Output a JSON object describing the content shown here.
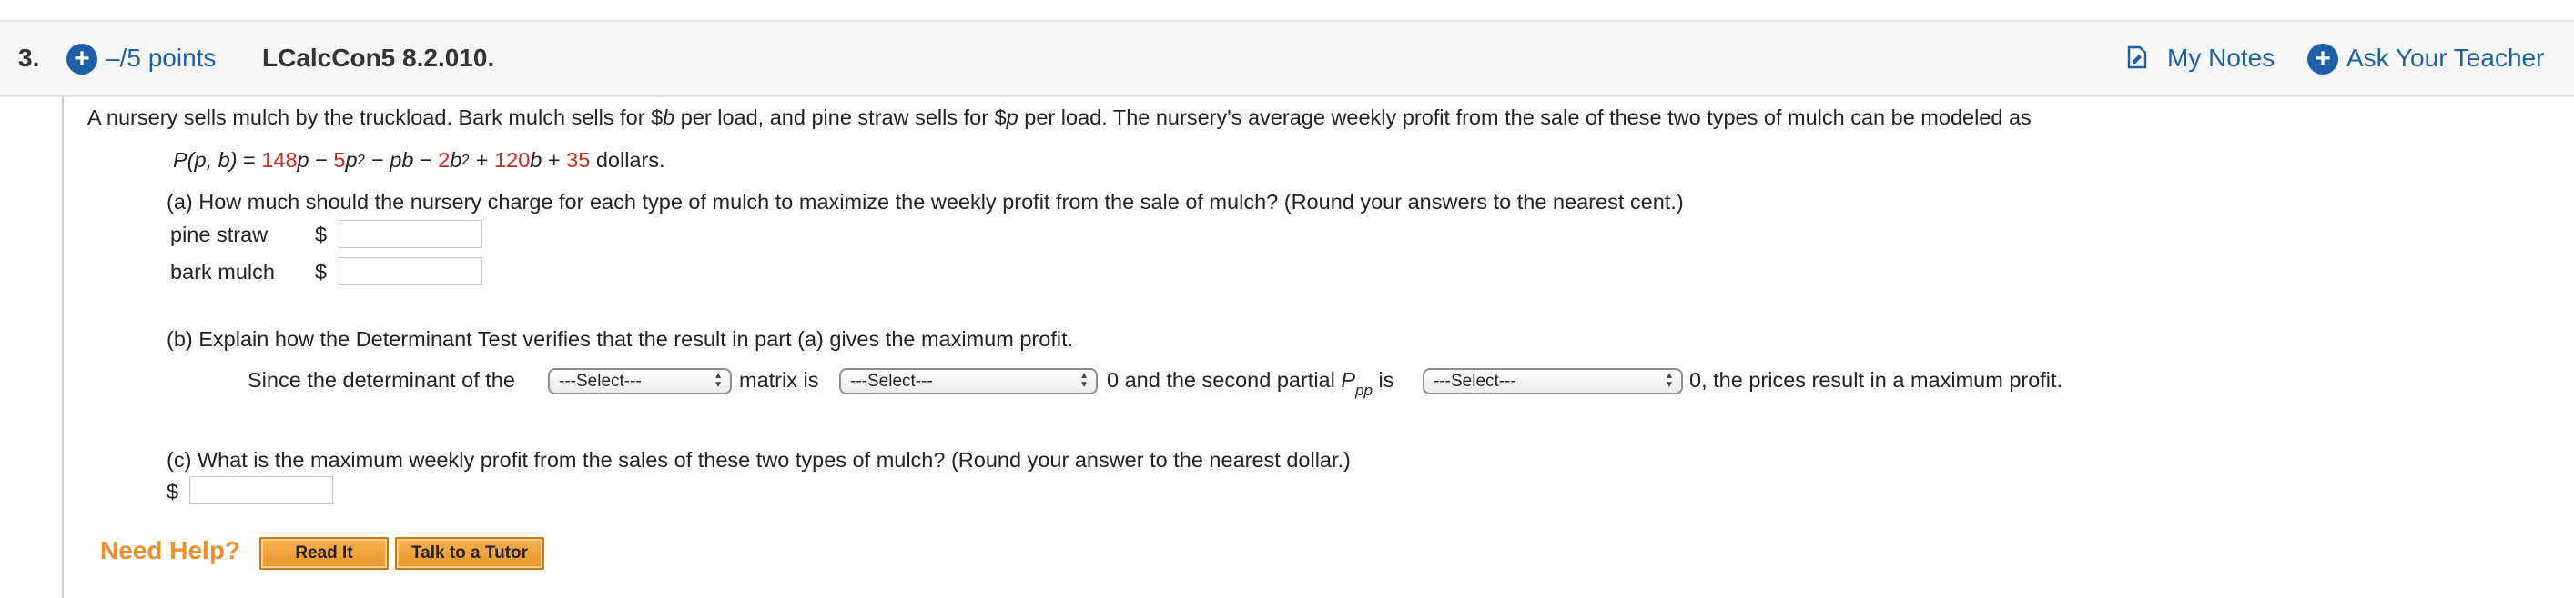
{
  "header": {
    "question_number": "3.",
    "points_text": "–/5 points",
    "question_id": "LCalcCon5 8.2.010.",
    "my_notes_label": "My Notes",
    "ask_teacher_label": "Ask Your Teacher"
  },
  "problem": {
    "intro_1": "A nursery sells mulch by the truckload. Bark mulch sells for $",
    "var_b": "b",
    "intro_2": " per load, and pine straw sells for $",
    "var_p": "p",
    "intro_3": " per load. The nursery's average weekly profit from the sale of these two types of mulch can be modeled as",
    "formula": {
      "lhs": "P(p, b)",
      "eq": " = ",
      "c1": "148",
      "t1": "p",
      "m1": " − ",
      "c2": "5",
      "t2": "p",
      "exp2": "2",
      "m2": " − ",
      "t3": "pb",
      "m3": " − ",
      "c4": "2",
      "t4": "b",
      "exp4": "2",
      "p5": " + ",
      "c5": "120",
      "t5": "b",
      "p6": " + ",
      "c6": "35",
      "unit": " dollars."
    }
  },
  "part_a": {
    "question": "(a) How much should the nursery charge for each type of mulch to maximize the weekly profit from the sale of mulch? (Round your answers to the nearest cent.)",
    "pine_label": "pine straw",
    "bark_label": "bark mulch",
    "currency": "$",
    "pine_value": "",
    "bark_value": ""
  },
  "part_b": {
    "question": "(b) Explain how the Determinant Test verifies that the result in part (a) gives the maximum profit.",
    "text_1": "Since the determinant of the",
    "text_2": "matrix is",
    "text_3a": "0 and the second partial ",
    "partial_var": "P",
    "partial_sub": "pp",
    "text_3b": " is",
    "text_4": "0, the prices result in a maximum profit.",
    "select_1": "---Select---",
    "select_2": "---Select---",
    "select_3": "---Select---"
  },
  "part_c": {
    "question": "(c) What is the maximum weekly profit from the sales of these two types of mulch? (Round your answer to the nearest dollar.)",
    "currency": "$",
    "value": ""
  },
  "help": {
    "need_help": "Need Help?",
    "read_it": "Read It",
    "talk_to_tutor": "Talk to a Tutor"
  },
  "colors": {
    "link_blue": "#1d5fa8",
    "highlight_red": "#d0281b",
    "help_orange": "#ef8e2b",
    "button_orange": "#f7b24d"
  },
  "icons": {
    "points_icon": "plus-circle-icon",
    "notes_icon": "notes-document-icon",
    "ask_icon": "plus-circle-icon",
    "select_icon": "up-down-arrows-icon"
  }
}
